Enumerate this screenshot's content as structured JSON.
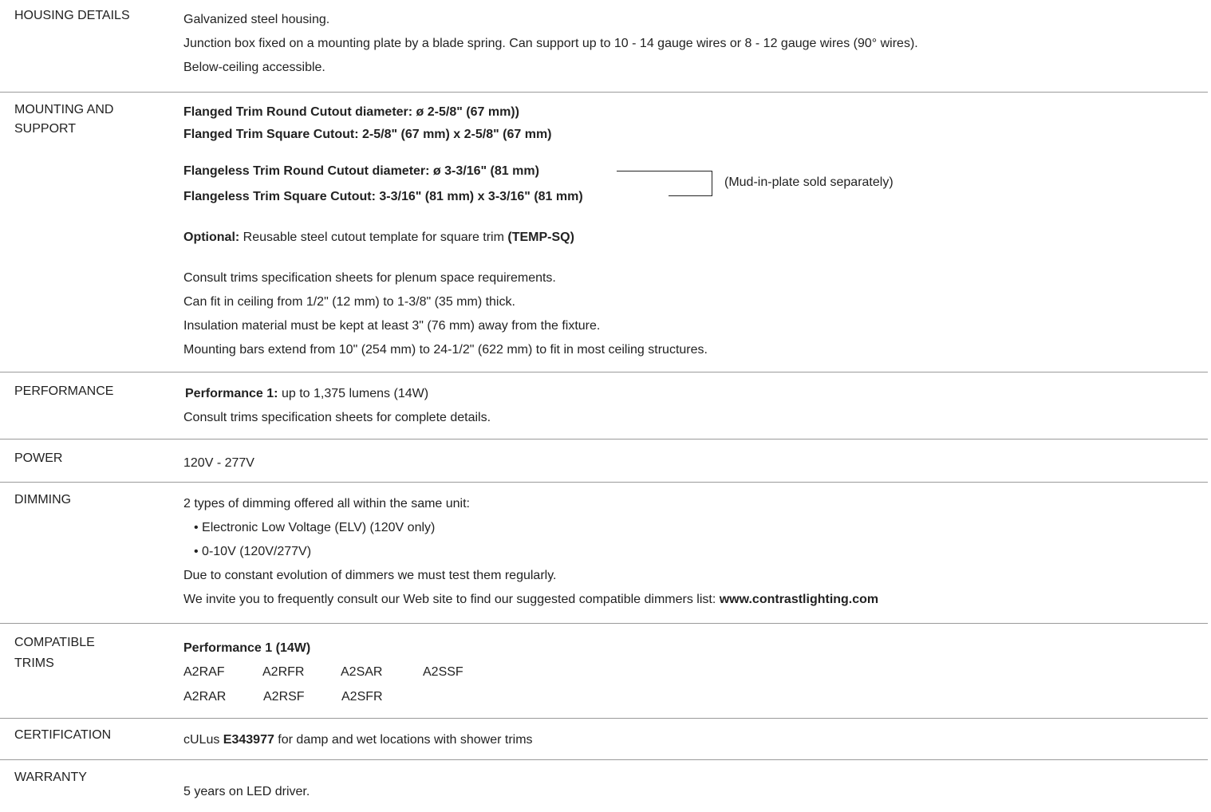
{
  "housing": {
    "label": "HOUSING DETAILS",
    "lines": [
      "Galvanized steel housing.",
      "Junction box fixed on a mounting plate by a blade spring. Can support up to 10 - 14 gauge wires or 8 - 12 gauge wires (90° wires).",
      "Below-ceiling accessible."
    ]
  },
  "mounting": {
    "label_1": "MOUNTING AND",
    "label_2": "SUPPORT",
    "flanged_round": "Flanged Trim Round Cutout diameter:  ø 2-5/8\" (67 mm))",
    "flanged_square": "Flanged Trim Square Cutout: 2-5/8\" (67 mm) x 2-5/8\" (67 mm)",
    "flangeless_round": "Flangeless Trim Round Cutout diameter: ø 3-3/16\" (81 mm)",
    "flangeless_square": "Flangeless Trim Square Cutout: 3-3/16\" (81 mm) x 3-3/16\" (81 mm)",
    "mud_note": "(Mud-in-plate sold separately)",
    "optional_label": "Optional:",
    "optional_text": " Reusable steel cutout template for square trim ",
    "optional_code": "(TEMP-SQ)",
    "notes": [
      "Consult trims specification sheets for plenum space requirements.",
      "Can fit in ceiling from 1/2\" (12 mm) to 1-3/8\" (35 mm) thick.",
      "Insulation material must be kept at least 3\" (76 mm) away from the fixture.",
      "Mounting bars extend from 10\" (254 mm) to 24-1/2\" (622 mm) to fit in most ceiling structures."
    ]
  },
  "performance": {
    "label": "PERFORMANCE",
    "bold": "Performance 1:",
    "text": " up to 1,375 lumens (14W)",
    "line2": "Consult trims specification sheets for complete details."
  },
  "power": {
    "label": "POWER",
    "value": "120V - 277V"
  },
  "dimming": {
    "label": "DIMMING",
    "intro": "2 types of dimming offered all within the same unit:",
    "bullets": [
      "• Electronic Low Voltage (ELV) (120V only)",
      "• 0-10V (120V/277V)"
    ],
    "line3": "Due to constant evolution of dimmers we must test them regularly.",
    "line4": "We invite you to frequently consult our Web site to find our suggested compatible dimmers list: ",
    "url": "www.contrastlighting.com"
  },
  "trims": {
    "label_1": "COMPATIBLE",
    "label_2": "TRIMS",
    "heading": "Performance 1 (14W)",
    "row1": [
      "A2RAF",
      "A2RFR",
      "A2SAR",
      "A2SSF"
    ],
    "row2": [
      "A2RAR",
      "A2RSF",
      "A2SFR"
    ]
  },
  "certification": {
    "label": "CERTIFICATION",
    "prefix": "cULus ",
    "code": "E343977",
    "suffix": " for damp and wet locations with shower trims"
  },
  "warranty": {
    "label": "WARRANTY",
    "value": "5 years on LED driver."
  }
}
